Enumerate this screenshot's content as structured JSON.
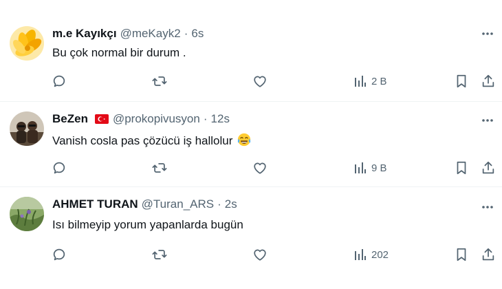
{
  "colors": {
    "text_primary": "#0f1419",
    "text_secondary": "#536471",
    "divider": "#eff3f4",
    "background": "#ffffff"
  },
  "tweets": [
    {
      "display_name": "m.e Kayıkçı",
      "handle": "@meKayk2",
      "separator": "·",
      "time": "6s",
      "text": "Bu çok normal bir durum .",
      "views": "2 B",
      "avatar": "yellow-flower-avatar",
      "flag": null,
      "emoji": null
    },
    {
      "display_name": "BeZen",
      "handle": "@prokopivusyon",
      "separator": "·",
      "time": "12s",
      "text": "Vanish cosla pas çözücü iş hallolur",
      "views": "9 B",
      "avatar": "people-photo-avatar",
      "flag": "turkey-flag-icon",
      "emoji": "face-with-tears-of-joy-icon"
    },
    {
      "display_name": "AHMET TURAN",
      "handle": "@Turan_ARS",
      "separator": "·",
      "time": "2s",
      "text": "Isı bilmeyip yorum yapanlarda bugün",
      "views": "202",
      "avatar": "nature-photo-avatar",
      "flag": null,
      "emoji": null
    }
  ],
  "icons": {
    "reply": "reply-icon",
    "retweet": "retweet-icon",
    "like": "heart-icon",
    "views": "views-bar-chart-icon",
    "bookmark": "bookmark-icon",
    "share": "share-icon",
    "more": "more-dots-icon"
  }
}
